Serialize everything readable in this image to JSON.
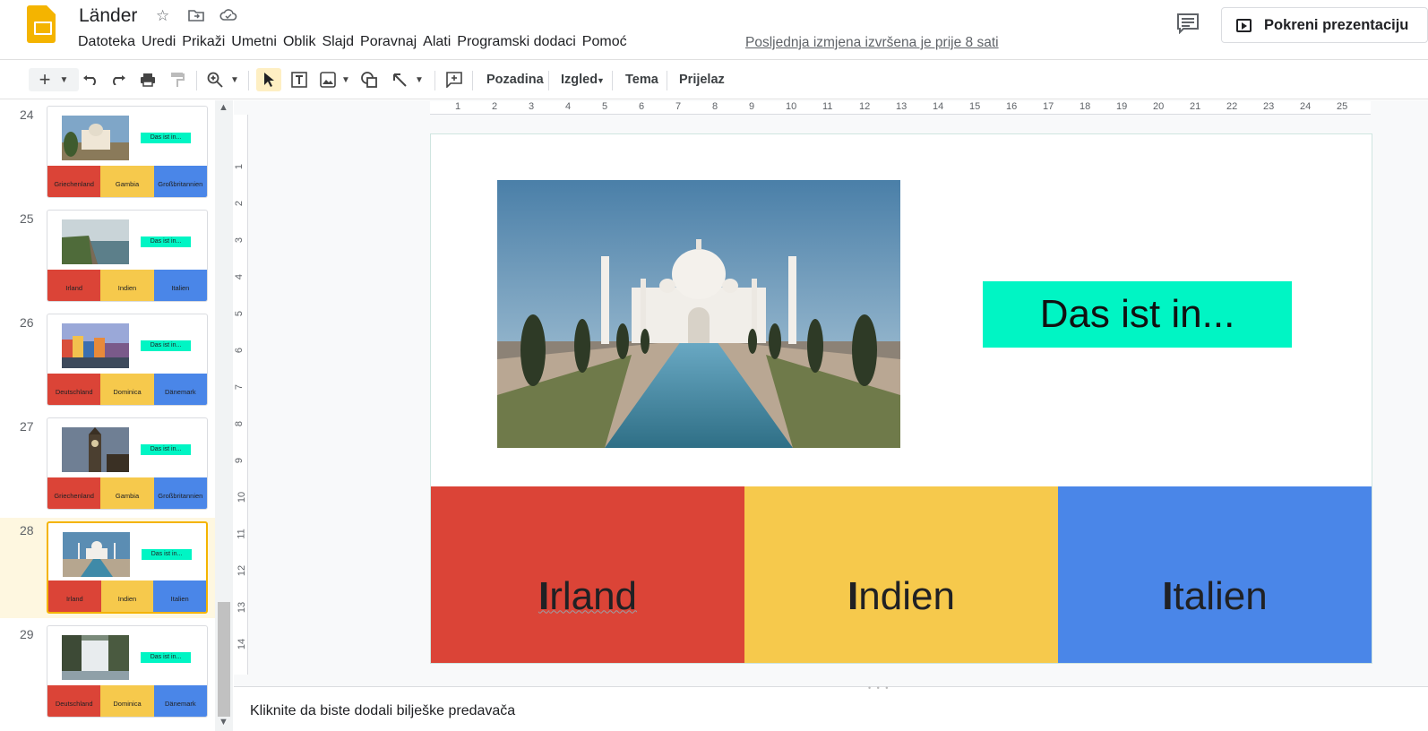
{
  "doc": {
    "title": "Länder",
    "last_edit": "Posljednja izmjena izvršena je prije 8 sati",
    "present_label": "Pokreni prezentaciju"
  },
  "menu": [
    "Datoteka",
    "Uredi",
    "Prikaži",
    "Umetni",
    "Oblik",
    "Slajd",
    "Poravnaj",
    "Alati",
    "Programski dodaci",
    "Pomoć"
  ],
  "toolbar": {
    "background": "Pozadina",
    "layout": "Izgled",
    "theme": "Tema",
    "transition": "Prijelaz"
  },
  "slides": [
    {
      "num": "24",
      "label": "Das ist in...",
      "a": "Griechenland",
      "b": "Gambia",
      "c": "Großbritannien",
      "scene": "building"
    },
    {
      "num": "25",
      "label": "Das ist in...",
      "a": "Irland",
      "b": "Indien",
      "c": "Italien",
      "scene": "cliffs"
    },
    {
      "num": "26",
      "label": "Das ist in...",
      "a": "Deutschland",
      "b": "Dominica",
      "c": "Dänemark",
      "scene": "houses"
    },
    {
      "num": "27",
      "label": "Das ist in...",
      "a": "Griechenland",
      "b": "Gambia",
      "c": "Großbritannien",
      "scene": "bigben"
    },
    {
      "num": "28",
      "label": "Das ist in...",
      "a": "Irland",
      "b": "Indien",
      "c": "Italien",
      "scene": "tajmahal"
    },
    {
      "num": "29",
      "label": "Das ist in...",
      "a": "Deutschland",
      "b": "Dominica",
      "c": "Dänemark",
      "scene": "waterfall"
    }
  ],
  "current": {
    "label": "Das ist in...",
    "options": [
      {
        "initial": "I",
        "rest": "rland"
      },
      {
        "initial": "I",
        "rest": "ndien"
      },
      {
        "initial": "I",
        "rest": "talien"
      }
    ]
  },
  "colors": {
    "red": "#db4437",
    "yellow": "#f6c94c",
    "blue": "#4a86e8",
    "mint": "#00f5c4",
    "accent": "#f4b400"
  },
  "ruler": {
    "h": [
      "1",
      "2",
      "3",
      "4",
      "5",
      "6",
      "7",
      "8",
      "9",
      "10",
      "11",
      "12",
      "13",
      "14",
      "15",
      "16",
      "17",
      "18",
      "19",
      "20",
      "21",
      "22",
      "23",
      "24",
      "25"
    ],
    "v": [
      "1",
      "2",
      "3",
      "4",
      "5",
      "6",
      "7",
      "8",
      "9",
      "10",
      "11",
      "12",
      "13",
      "14"
    ]
  },
  "notes": {
    "placeholder": "Kliknite da biste dodali bilješke predavača"
  }
}
